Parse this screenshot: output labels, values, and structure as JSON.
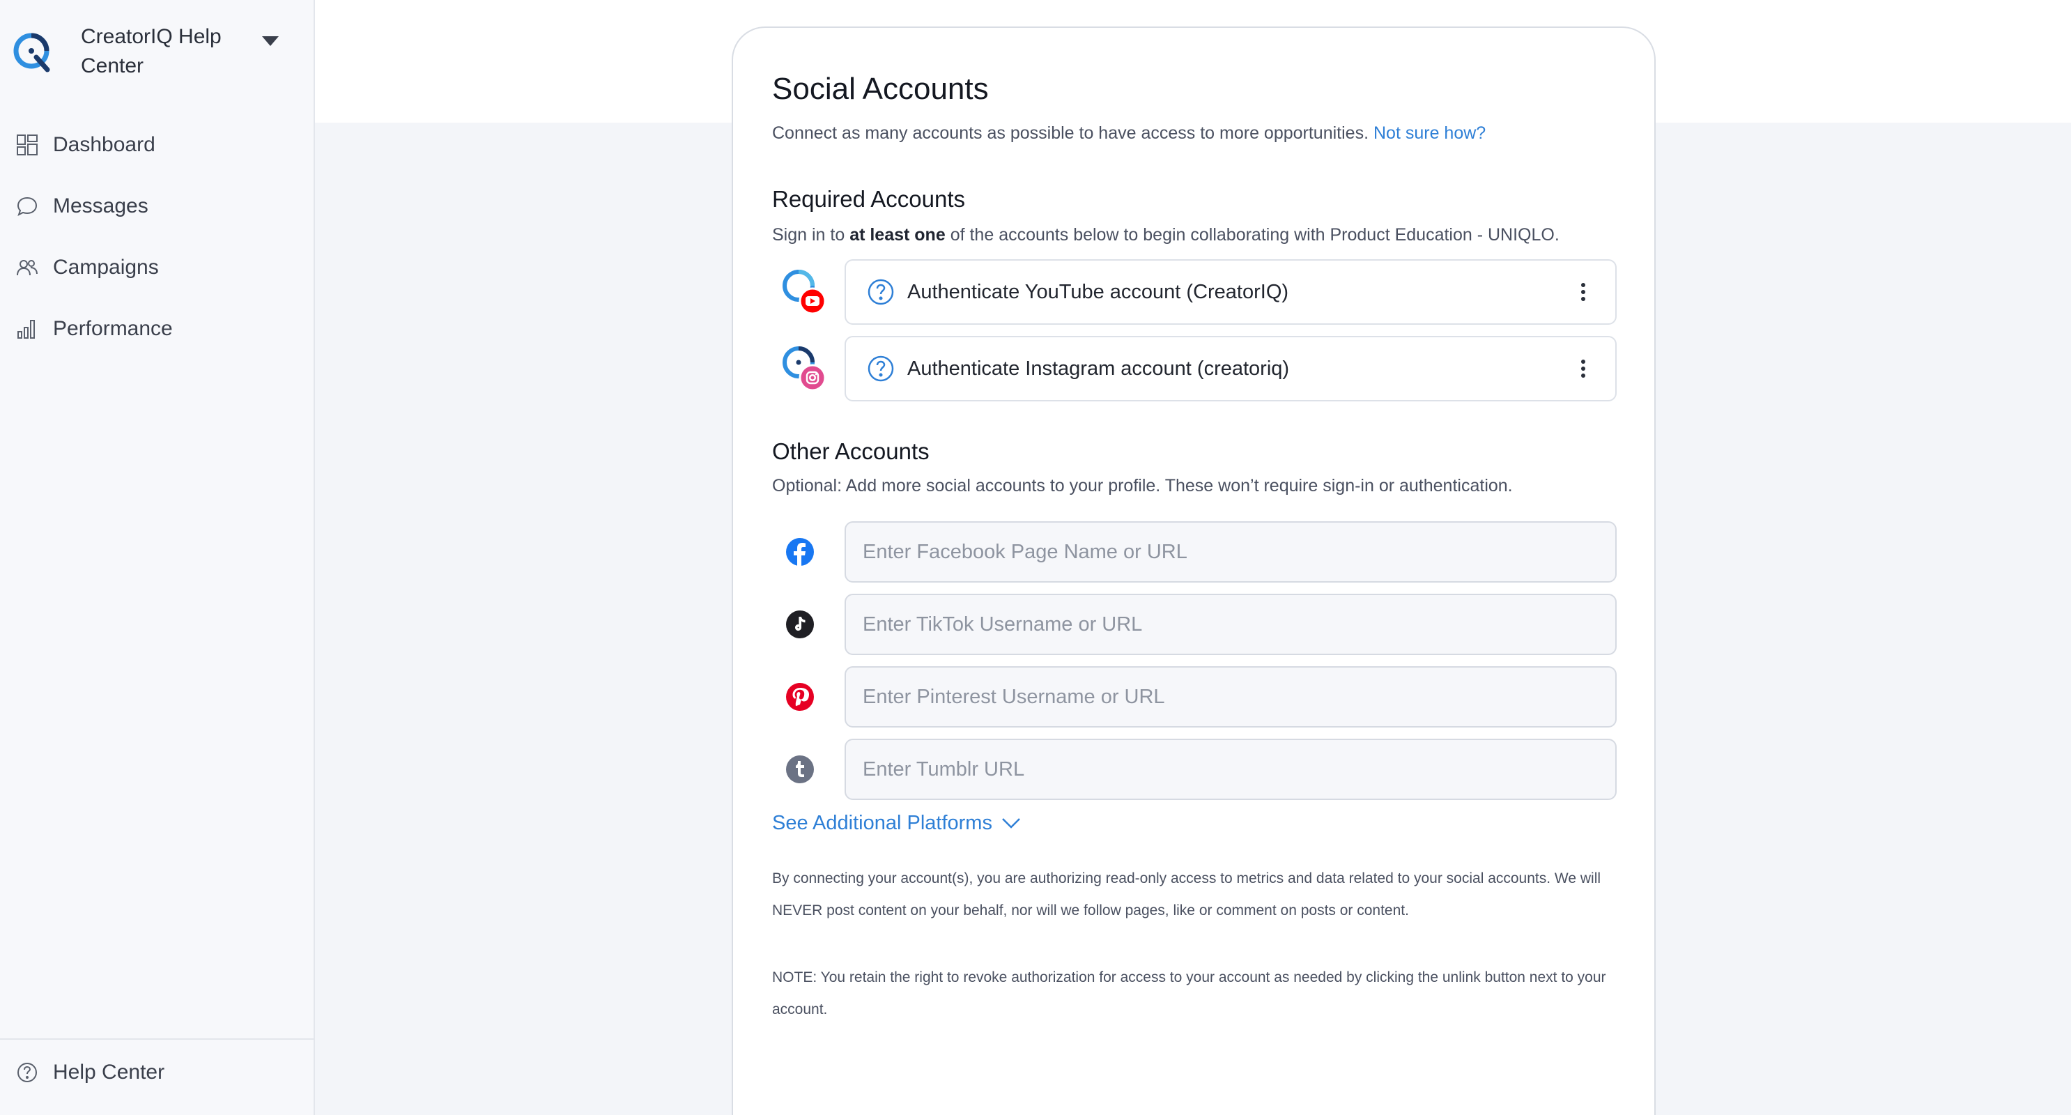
{
  "sidebar": {
    "brand": "CreatorIQ Help Center",
    "items": [
      {
        "label": "Dashboard",
        "icon": "dashboard-grid-icon"
      },
      {
        "label": "Messages",
        "icon": "chat-bubble-icon"
      },
      {
        "label": "Campaigns",
        "icon": "people-icon"
      },
      {
        "label": "Performance",
        "icon": "bar-chart-icon"
      }
    ],
    "help": {
      "label": "Help Center",
      "icon": "question-circle-icon"
    }
  },
  "main": {
    "title": "Social Accounts",
    "subtitle": "Connect as many accounts as possible to have access to more opportunities.",
    "subtitle_link": "Not sure how?",
    "required": {
      "heading": "Required Accounts",
      "desc_prefix": "Sign in to ",
      "desc_bold": "at least one",
      "desc_suffix": " of the accounts below to begin collaborating with Product Education - UNIQLO.",
      "accounts": [
        {
          "label": "Authenticate YouTube account  (CreatorIQ)",
          "platform": "youtube"
        },
        {
          "label": "Authenticate Instagram account  (creatoriq)",
          "platform": "instagram"
        }
      ]
    },
    "other": {
      "heading": "Other Accounts",
      "desc": "Optional: Add more social accounts to your profile. These won’t require sign-in or authentication.",
      "fields": [
        {
          "platform": "facebook",
          "placeholder": "Enter Facebook Page Name or URL",
          "value": ""
        },
        {
          "platform": "tiktok",
          "placeholder": "Enter TikTok Username or URL",
          "value": ""
        },
        {
          "platform": "pinterest",
          "placeholder": "Enter Pinterest Username or URL",
          "value": ""
        },
        {
          "platform": "tumblr",
          "placeholder": "Enter Tumblr URL",
          "value": ""
        }
      ],
      "see_more": "See Additional Platforms"
    },
    "disclaimer1": "By connecting your account(s), you are authorizing read-only access to metrics and data related to your social accounts. We will NEVER post content on your behalf, nor will we follow pages, like or comment on posts or content.",
    "disclaimer2": "NOTE: You retain the right to revoke authorization for access to your account as needed by clicking the unlink button next to your account."
  },
  "colors": {
    "accent": "#2e7fd6",
    "brand_dark": "#1b3a6b",
    "youtube": "#ff0000",
    "facebook": "#1877f2",
    "pinterest": "#e60023",
    "tumblr": "#6b7284",
    "tiktok": "#1f1f24"
  }
}
